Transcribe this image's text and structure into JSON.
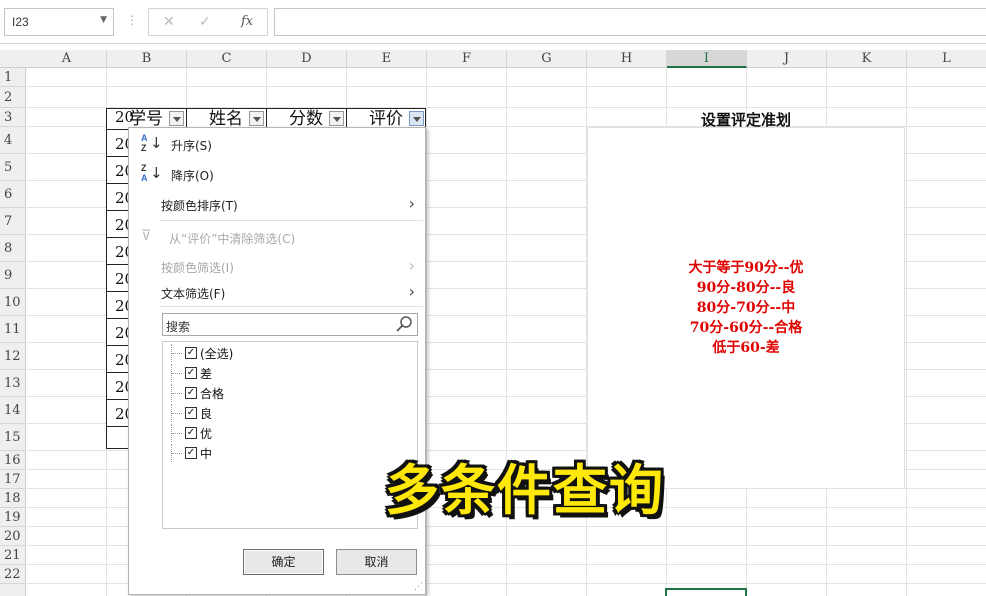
{
  "formula_bar": {
    "name_box": "I23",
    "cancel_icon": "✕",
    "enter_icon": "✓",
    "fx_label": "fx",
    "formula": ""
  },
  "columns": [
    "A",
    "B",
    "C",
    "D",
    "E",
    "F",
    "G",
    "H",
    "I",
    "J",
    "K",
    "L"
  ],
  "selected_column": "I",
  "rows": [
    "1",
    "2",
    "3",
    "4",
    "5",
    "6",
    "7",
    "8",
    "9",
    "10",
    "11",
    "12",
    "13",
    "14",
    "15",
    "16",
    "17",
    "18",
    "19",
    "20",
    "21",
    "22"
  ],
  "table": {
    "headers": [
      "学号",
      "姓名",
      "分数",
      "评价"
    ],
    "id_fragments": [
      "20",
      "20",
      "20",
      "20",
      "20",
      "20",
      "20",
      "20",
      "20",
      "20",
      "20",
      "20"
    ]
  },
  "filter_menu": {
    "sort_asc": "升序(S)",
    "sort_desc": "降序(O)",
    "sort_by_color": "按颜色排序(T)",
    "clear_filter": "从“评价”中清除筛选(C)",
    "filter_by_color": "按颜色筛选(I)",
    "text_filter": "文本筛选(F)",
    "search_placeholder": "搜索",
    "items": [
      {
        "label": "(全选)",
        "checked": true
      },
      {
        "label": "差",
        "checked": true
      },
      {
        "label": "合格",
        "checked": true
      },
      {
        "label": "良",
        "checked": true
      },
      {
        "label": "优",
        "checked": true
      },
      {
        "label": "中",
        "checked": true
      }
    ],
    "ok_label": "确定",
    "cancel_label": "取消",
    "check_mark": "✓"
  },
  "criteria": {
    "title": "设置评定准划",
    "lines": [
      "大于等于90分--优",
      "90分-80分--良",
      "80分-70分--中",
      "70分-60分--合格",
      "低于60-差"
    ],
    "color": "#e00000"
  },
  "caption": "多条件查询",
  "colors": {
    "accent_green": "#217346",
    "caption_yellow": "#ffe80a"
  }
}
